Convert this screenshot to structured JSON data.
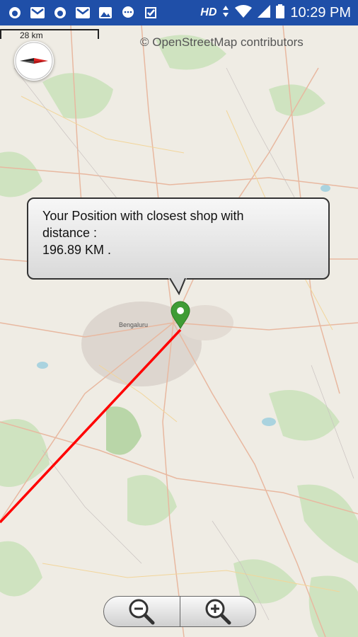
{
  "status_bar": {
    "network": "HD",
    "time": "10:29 PM"
  },
  "map": {
    "scale_label": "28 km",
    "attribution": "© OpenStreetMap contributors",
    "city_label": "Bengaluru",
    "callout_lines": [
      "Your Position with closest shop with",
      "distance :",
      "196.89 KM ."
    ],
    "route_color": "#ff0000",
    "pin_color": "#3f9c35"
  },
  "zoom": {
    "out_icon": "zoom-out-icon",
    "in_icon": "zoom-in-icon"
  }
}
